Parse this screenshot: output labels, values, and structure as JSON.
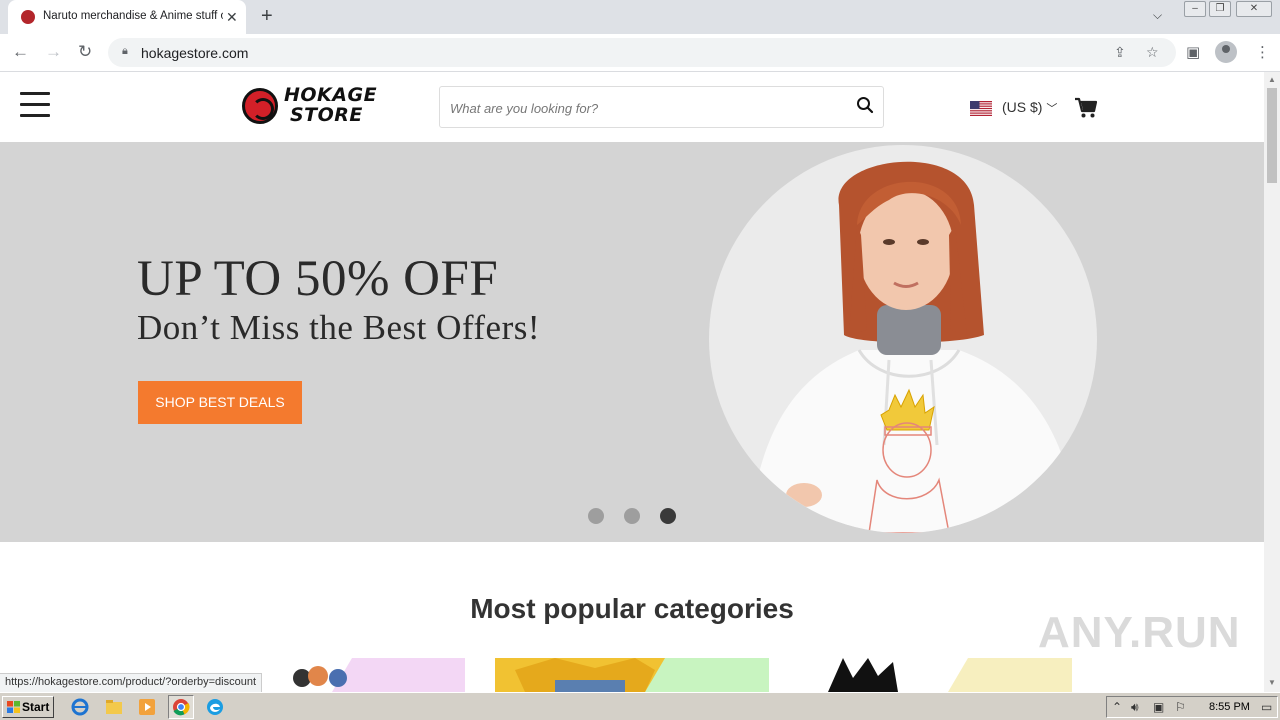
{
  "browser": {
    "tab_title": "Naruto merchandise & Anime stuff o",
    "url": "hokagestore.com",
    "status_url": "https://hokagestore.com/product/?orderby=discount"
  },
  "site": {
    "logo_line1": "HOKAGE",
    "logo_line2": "STORE",
    "search_placeholder": "What are you looking for?",
    "currency": "(US $)",
    "brand_accent": "#f47a2e",
    "hero": {
      "heading": "UP TO 50% OFF",
      "subheading": "Don’t Miss the Best Offers!",
      "button_label": "SHOP BEST DEALS",
      "slide_count": 3,
      "active_slide": 3
    },
    "section_title": "Most popular categories"
  },
  "watermark": "ANY.RUN",
  "taskbar": {
    "start_label": "Start",
    "clock": "8:55 PM"
  }
}
